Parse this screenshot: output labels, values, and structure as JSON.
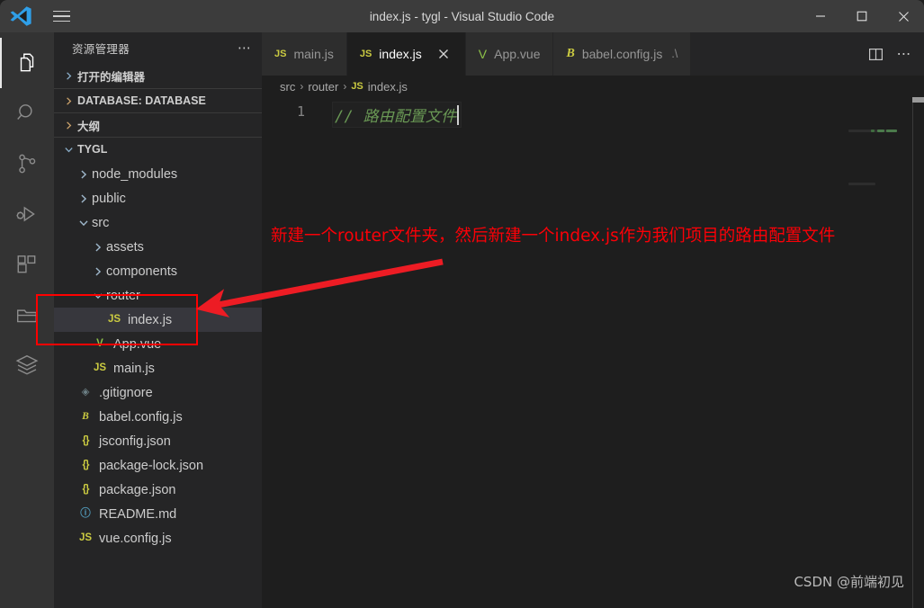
{
  "window": {
    "title": "index.js - tygl - Visual Studio Code",
    "logo_icon": "vscode-logo-icon",
    "menu_icon": "hamburger-menu-icon",
    "controls": [
      {
        "name": "minimize-button",
        "icon": "minimize-icon"
      },
      {
        "name": "maximize-button",
        "icon": "maximize-icon"
      },
      {
        "name": "close-button",
        "icon": "close-icon"
      }
    ]
  },
  "activity_bar": {
    "items": [
      {
        "name": "explorer",
        "icon": "files-icon",
        "active": true
      },
      {
        "name": "search",
        "icon": "search-icon",
        "active": false
      },
      {
        "name": "source-control",
        "icon": "source-control-icon",
        "active": false
      },
      {
        "name": "run-and-debug",
        "icon": "run-debug-icon",
        "active": false
      },
      {
        "name": "extensions",
        "icon": "extensions-icon",
        "active": false
      },
      {
        "name": "remote-explorer",
        "icon": "folder-icon",
        "active": false
      },
      {
        "name": "layers",
        "icon": "layers-icon",
        "active": false
      }
    ]
  },
  "sidebar": {
    "header_title": "资源管理器",
    "header_actions_icon": "more-actions-icon",
    "sections": [
      {
        "label": "打开的编辑器",
        "expanded": false
      },
      {
        "label": "DATABASE: DATABASE",
        "expanded": false
      },
      {
        "label": "大纲",
        "expanded": false
      },
      {
        "label": "TYGL",
        "expanded": true
      }
    ],
    "tree": [
      {
        "label": "node_modules",
        "type": "folder",
        "indent": 1,
        "expanded": false,
        "icon": "chevron-right-icon",
        "selected": false
      },
      {
        "label": "public",
        "type": "folder",
        "indent": 1,
        "expanded": false,
        "icon": "chevron-right-icon",
        "selected": false
      },
      {
        "label": "src",
        "type": "folder",
        "indent": 1,
        "expanded": true,
        "icon": "chevron-down-icon",
        "selected": false
      },
      {
        "label": "assets",
        "type": "folder",
        "indent": 2,
        "expanded": false,
        "icon": "chevron-right-icon",
        "selected": false
      },
      {
        "label": "components",
        "type": "folder",
        "indent": 2,
        "expanded": false,
        "icon": "chevron-right-icon",
        "selected": false
      },
      {
        "label": "router",
        "type": "folder",
        "indent": 2,
        "expanded": true,
        "icon": "chevron-down-icon",
        "selected": false
      },
      {
        "label": "index.js",
        "type": "file",
        "indent": 3,
        "badge": "JS",
        "badge_class": "js-badge",
        "selected": true
      },
      {
        "label": "App.vue",
        "type": "file",
        "indent": 2,
        "badge": "V",
        "badge_class": "vue-badge",
        "selected": false
      },
      {
        "label": "main.js",
        "type": "file",
        "indent": 2,
        "badge": "JS",
        "badge_class": "js-badge",
        "selected": false
      },
      {
        "label": ".gitignore",
        "type": "file",
        "indent": 1,
        "badge": "◈",
        "badge_class": "git-badge",
        "selected": false
      },
      {
        "label": "babel.config.js",
        "type": "file",
        "indent": 1,
        "badge": "B",
        "badge_class": "babel-badge",
        "selected": false
      },
      {
        "label": "jsconfig.json",
        "type": "file",
        "indent": 1,
        "badge": "{}",
        "badge_class": "brace-badge",
        "selected": false
      },
      {
        "label": "package-lock.json",
        "type": "file",
        "indent": 1,
        "badge": "{}",
        "badge_class": "brace-badge",
        "selected": false
      },
      {
        "label": "package.json",
        "type": "file",
        "indent": 1,
        "badge": "{}",
        "badge_class": "brace-badge",
        "selected": false
      },
      {
        "label": "README.md",
        "type": "file",
        "indent": 1,
        "badge": "ⓘ",
        "badge_class": "md-badge",
        "selected": false
      },
      {
        "label": "vue.config.js",
        "type": "file",
        "indent": 1,
        "badge": "JS",
        "badge_class": "js-badge",
        "selected": false
      }
    ]
  },
  "editor": {
    "tabs": [
      {
        "label": "main.js",
        "badge": "JS",
        "badge_class": "js-badge",
        "active": false,
        "closable": false,
        "suffix": ""
      },
      {
        "label": "index.js",
        "badge": "JS",
        "badge_class": "js-badge",
        "active": true,
        "closable": true,
        "suffix": ""
      },
      {
        "label": "App.vue",
        "badge": "V",
        "badge_class": "vue-badge",
        "active": false,
        "closable": false,
        "suffix": ""
      },
      {
        "label": "babel.config.js",
        "badge": "B",
        "badge_class": "babel-badge",
        "active": false,
        "closable": false,
        "suffix": ".\\"
      }
    ],
    "tab_actions": [
      {
        "name": "split-editor-button",
        "icon": "split-editor-icon"
      },
      {
        "name": "more-actions-button",
        "icon": "more-actions-icon"
      }
    ],
    "breadcrumb": [
      {
        "label": "src",
        "icon": null
      },
      {
        "label": "router",
        "icon": null
      },
      {
        "label": "index.js",
        "icon": "js-file-icon",
        "badge": "JS"
      }
    ],
    "breadcrumb_separator": "›",
    "code": {
      "line_numbers": [
        "1"
      ],
      "lines": [
        "// 路由配置文件"
      ],
      "cursor_visible": true,
      "comment_color": "#6A9955"
    },
    "watermark": "CSDN @前端初见"
  },
  "annotations": {
    "text": "新建一个router文件夹，然后新建一个index.js作为我们项目的路由配置文件",
    "color": "#ff0000",
    "box_label": "router-folder-highlight-box",
    "arrow_label": "annotation-arrow"
  }
}
